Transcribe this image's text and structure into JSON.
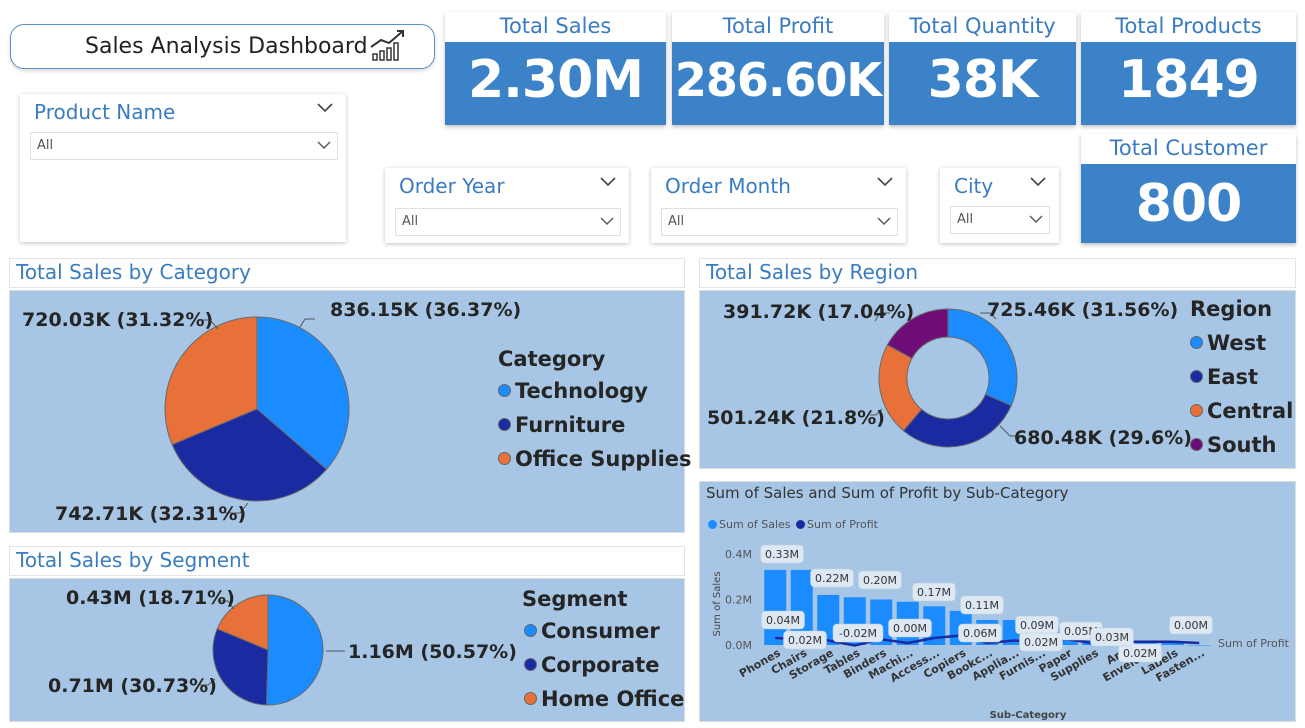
{
  "title": "Sales Analysis Dashboard",
  "kpis": {
    "total_sales": {
      "label": "Total Sales",
      "value": "2.30M"
    },
    "total_profit": {
      "label": "Total Profit",
      "value": "286.60K"
    },
    "total_quantity": {
      "label": "Total Quantity",
      "value": "38K"
    },
    "total_products": {
      "label": "Total Products",
      "value": "1849"
    },
    "total_customer": {
      "label": "Total Customer",
      "value": "800"
    }
  },
  "slicers": {
    "product_name": {
      "label": "Product Name",
      "value": "All"
    },
    "order_year": {
      "label": "Order Year",
      "value": "All"
    },
    "order_month": {
      "label": "Order Month",
      "value": "All"
    },
    "city": {
      "label": "City",
      "value": "All"
    }
  },
  "colors": {
    "kpi_blue": "#3c82c8",
    "panel_bg": "#a7c6e5",
    "technology": "#1a8cff",
    "furniture": "#1a2aa0",
    "office_supplies": "#e8713a",
    "south": "#6e0d78"
  },
  "category_panel": {
    "title": "Total Sales by Category",
    "legend_title": "Category"
  },
  "segment_panel": {
    "title": "Total Sales by Segment",
    "legend_title": "Segment"
  },
  "region_panel": {
    "title": "Total Sales by Region",
    "legend_title": "Region"
  },
  "combo_panel": {
    "title": "Sum of Sales and Sum of Profit by Sub-Category",
    "legend_sales": "Sum of Sales",
    "legend_profit": "Sum of Profit",
    "y_title": "Sum of Sales",
    "x_title": "Sub-Category",
    "profit_axis_label": "Sum of Profit"
  },
  "chart_data": [
    {
      "type": "pie",
      "title": "Total Sales by Category",
      "legend_title": "Category",
      "slices": [
        {
          "name": "Technology",
          "value": 836150,
          "label": "836.15K (36.37%)",
          "color": "#1a8cff"
        },
        {
          "name": "Furniture",
          "value": 742710,
          "label": "742.71K (32.31%)",
          "color": "#1a2aa0"
        },
        {
          "name": "Office Supplies",
          "value": 720030,
          "label": "720.03K (31.32%)",
          "color": "#e8713a"
        }
      ]
    },
    {
      "type": "pie",
      "title": "Total Sales by Segment",
      "legend_title": "Segment",
      "slices": [
        {
          "name": "Consumer",
          "value": 1160000,
          "label": "1.16M (50.57%)",
          "color": "#1a8cff"
        },
        {
          "name": "Corporate",
          "value": 710000,
          "label": "0.71M (30.73%)",
          "color": "#1a2aa0"
        },
        {
          "name": "Home Office",
          "value": 430000,
          "label": "0.43M (18.71%)",
          "color": "#e8713a"
        }
      ]
    },
    {
      "type": "pie",
      "donut": true,
      "title": "Total Sales by Region",
      "legend_title": "Region",
      "slices": [
        {
          "name": "West",
          "value": 725460,
          "label": "725.46K (31.56%)",
          "color": "#1a8cff"
        },
        {
          "name": "East",
          "value": 680480,
          "label": "680.48K (29.6%)",
          "color": "#1a2aa0"
        },
        {
          "name": "Central",
          "value": 501240,
          "label": "501.24K (21.8%)",
          "color": "#e8713a"
        },
        {
          "name": "South",
          "value": 391720,
          "label": "391.72K (17.04%)",
          "color": "#6e0d78"
        }
      ]
    },
    {
      "type": "bar",
      "title": "Sum of Sales and Sum of Profit by Sub-Category",
      "xlabel": "Sub-Category",
      "ylabel": "Sum of Sales",
      "ylim": [
        0,
        0.4
      ],
      "yticks": [
        "0.0M",
        "0.2M",
        "0.4M"
      ],
      "categories": [
        "Phones",
        "Chairs",
        "Storage",
        "Tables",
        "Binders",
        "Machi...",
        "Access...",
        "Copiers",
        "Bookc...",
        "Applia...",
        "Furnis...",
        "Paper",
        "Supplies",
        "Art",
        "Envelo...",
        "Labels",
        "Fasten..."
      ],
      "series": [
        {
          "name": "Sum of Sales",
          "type": "bar",
          "color": "#1a8cff",
          "values": [
            0.33,
            0.33,
            0.22,
            0.21,
            0.2,
            0.19,
            0.17,
            0.15,
            0.11,
            0.11,
            0.08,
            0.08,
            0.05,
            0.03,
            0.02,
            0.01,
            0.0
          ]
        },
        {
          "name": "Sum of Profit",
          "type": "line",
          "color": "#1a2aa0",
          "values": [
            0.04,
            0.03,
            0.02,
            -0.02,
            0.03,
            0.0,
            0.04,
            0.06,
            0.0,
            0.02,
            0.01,
            0.03,
            0.0,
            0.01,
            0.01,
            0.01,
            0.0
          ]
        }
      ],
      "data_labels": {
        "sales": [
          "0.33M",
          "0.22M",
          "0.20M",
          "0.17M",
          "0.11M",
          "0.09M",
          "0.05M",
          "0.02M",
          "0.00M"
        ],
        "profit": [
          "0.04M",
          "0.02M",
          "-0.02M",
          "0.00M",
          "0.06M",
          "0.02M",
          "0.03M"
        ]
      }
    }
  ]
}
